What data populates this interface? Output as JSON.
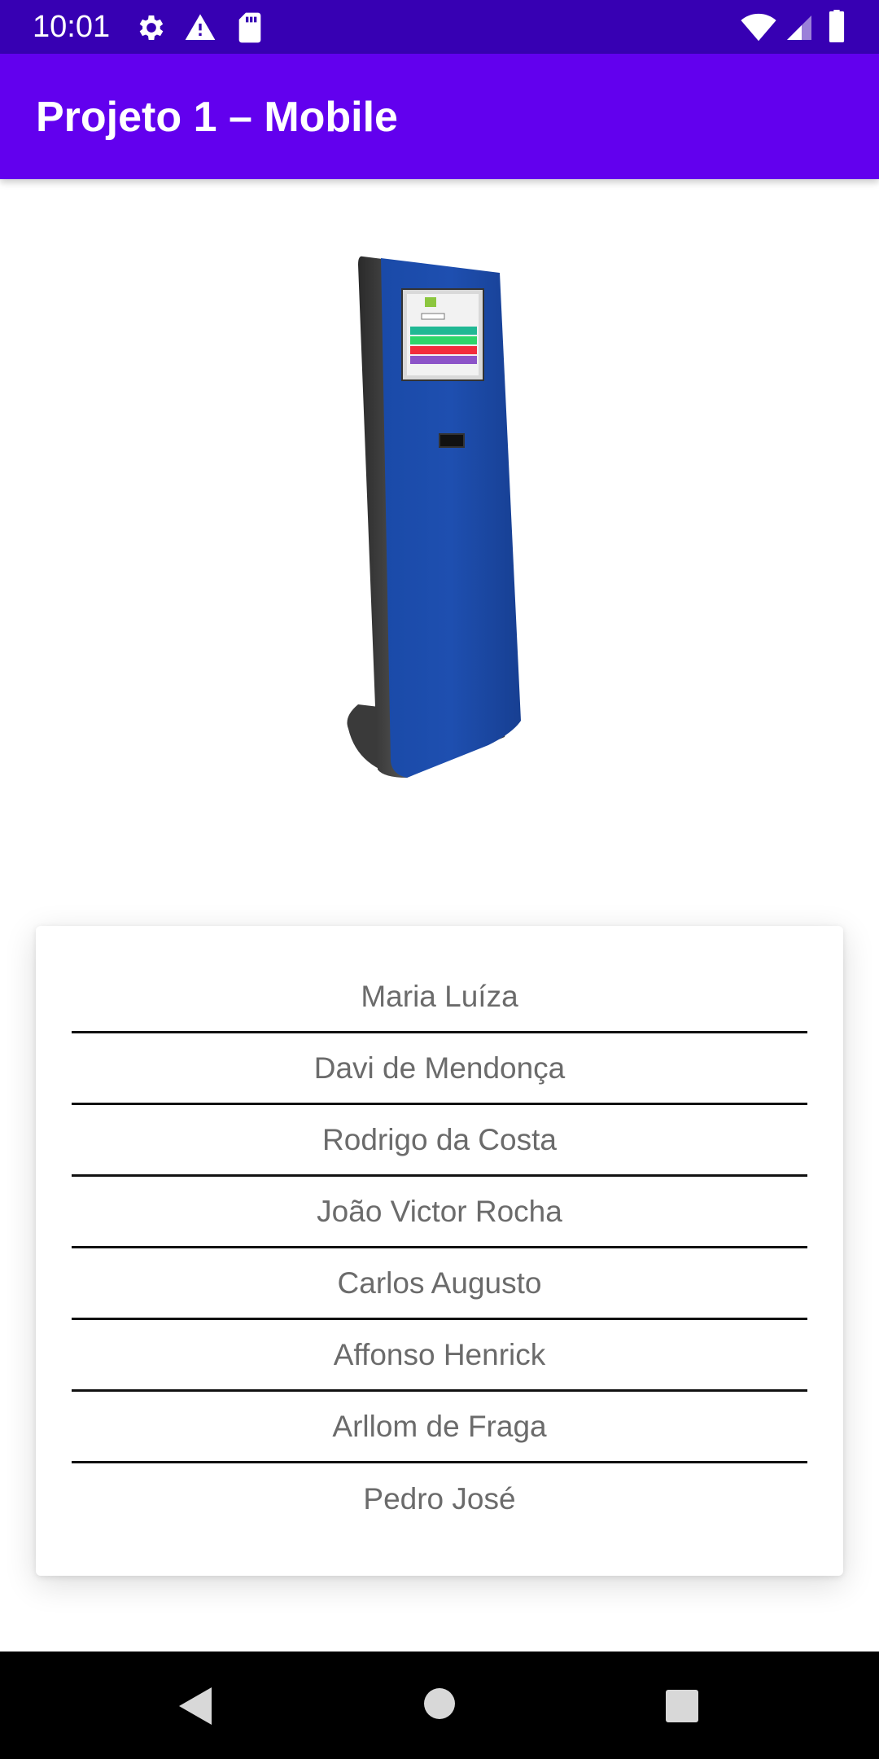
{
  "status_bar": {
    "time": "10:01",
    "icons_left": [
      "settings-icon",
      "alert-triangle-icon",
      "sd-card-icon"
    ],
    "icons_right": [
      "wifi-icon",
      "cellular-signal-icon",
      "battery-icon"
    ]
  },
  "app_bar": {
    "title": "Projeto 1 – Mobile",
    "color": "#6200ee",
    "status_color": "#3700b3"
  },
  "image": {
    "icon": "kiosk-totem-image"
  },
  "names": [
    "Maria Luíza",
    "Davi de Mendonça",
    "Rodrigo da Costa",
    "João Victor Rocha",
    "Carlos Augusto",
    "Affonso Henrick",
    "Arllom de Fraga",
    "Pedro José"
  ],
  "nav_bar": {
    "buttons": [
      "back-icon",
      "home-icon",
      "recents-icon"
    ]
  }
}
